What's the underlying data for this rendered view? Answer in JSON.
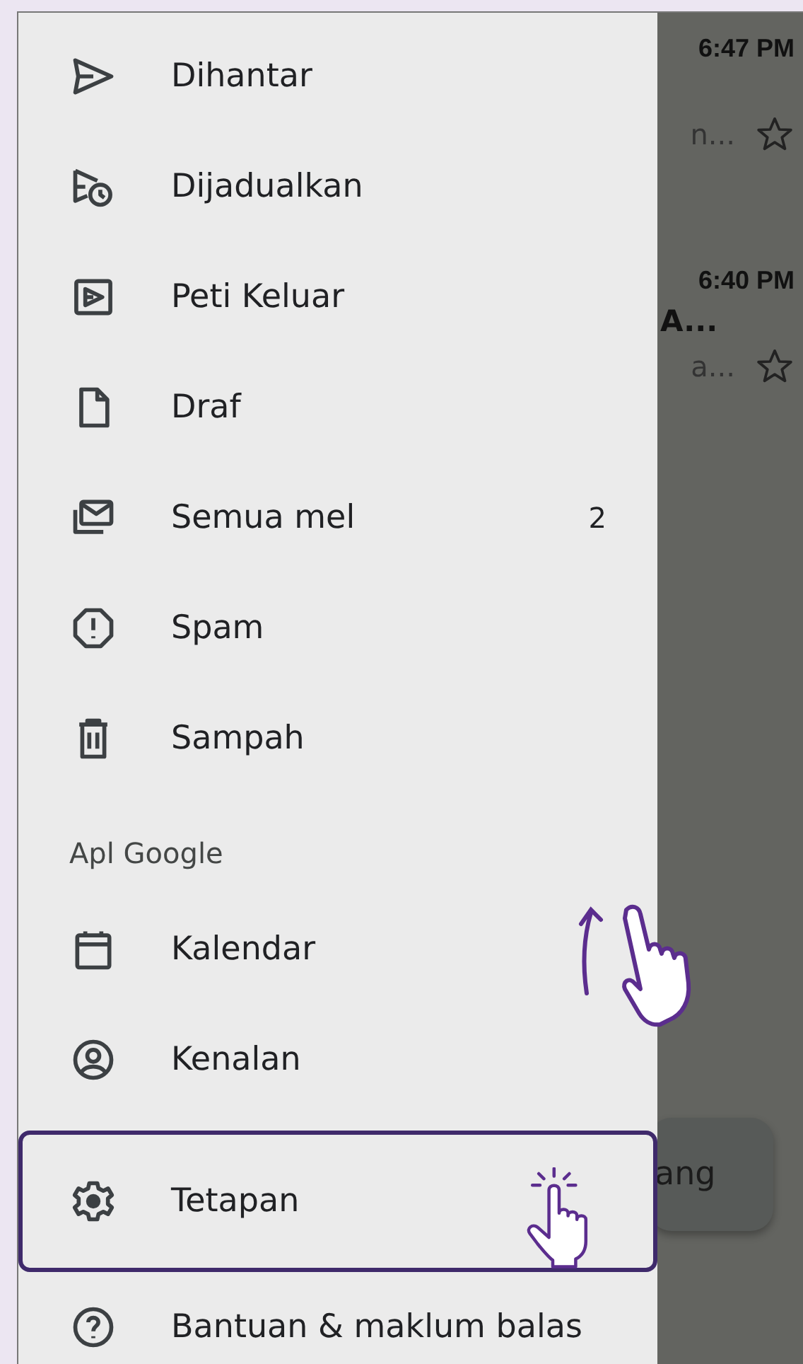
{
  "drawer": {
    "items": [
      {
        "kind": "item",
        "label": "Dihantar",
        "highlighted": false
      },
      {
        "kind": "item",
        "label": "Dijadualkan",
        "highlighted": false
      },
      {
        "kind": "item",
        "label": "Peti Keluar",
        "highlighted": false
      },
      {
        "kind": "item",
        "label": "Draf",
        "highlighted": false
      },
      {
        "kind": "item",
        "label": "Semua mel",
        "count": "2",
        "highlighted": false
      },
      {
        "kind": "item",
        "label": "Spam",
        "highlighted": false
      },
      {
        "kind": "item",
        "label": "Sampah",
        "highlighted": false
      },
      {
        "kind": "header",
        "label": "Apl Google"
      },
      {
        "kind": "item",
        "label": "Kalendar",
        "highlighted": false
      },
      {
        "kind": "item",
        "label": "Kenalan",
        "highlighted": false
      },
      {
        "kind": "item",
        "label": "Tetapan",
        "highlighted": true
      },
      {
        "kind": "item",
        "label": "Bantuan & maklum balas",
        "highlighted": false
      }
    ]
  },
  "mail_list": [
    {
      "time": "6:47 PM",
      "snippet": "n...",
      "starred": false
    },
    {
      "time": "6:40 PM",
      "subject": "A...",
      "snippet": "a...",
      "starred": false
    }
  ],
  "floating_button": {
    "label": "ang"
  }
}
